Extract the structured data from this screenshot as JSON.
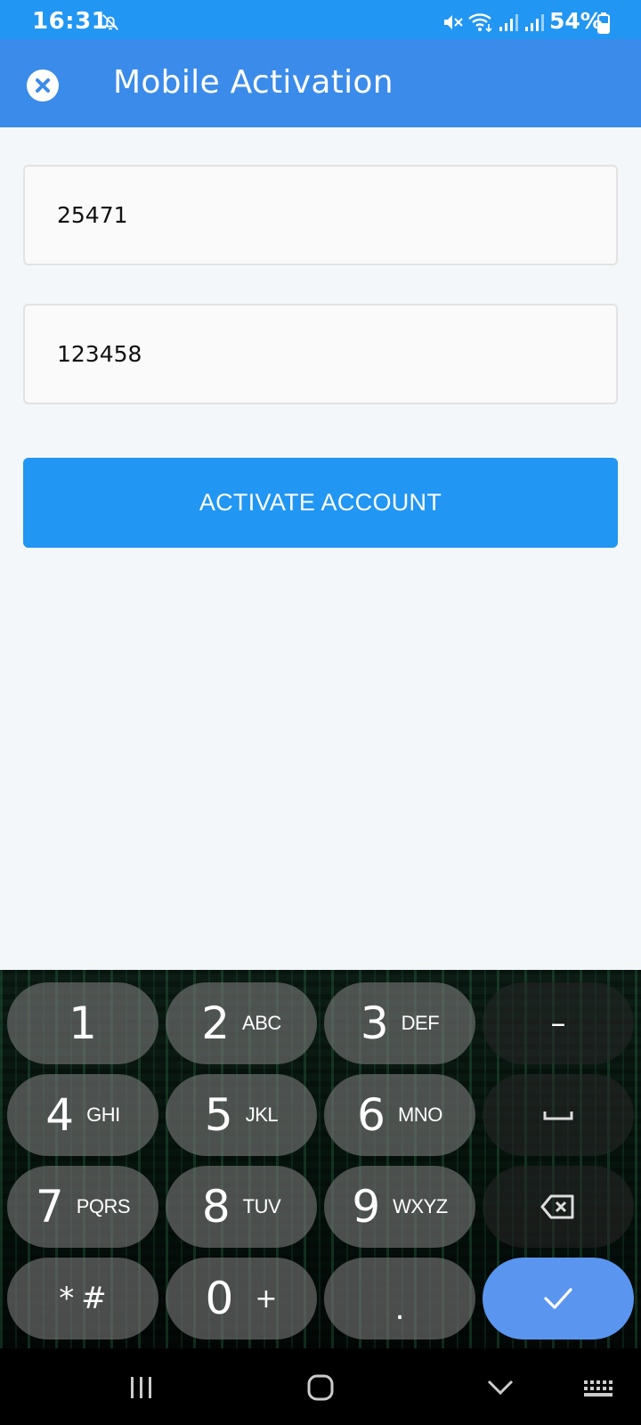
{
  "status_bar": {
    "time": "16:31",
    "battery_pct": "54%"
  },
  "app_bar": {
    "title": "Mobile Activation"
  },
  "form": {
    "account_value": "25471",
    "code_value": "123458",
    "activate_label": "ACTIVATE ACCOUNT"
  },
  "keyboard": {
    "keys": [
      {
        "num": "1",
        "sub": ""
      },
      {
        "num": "2",
        "sub": "ABC"
      },
      {
        "num": "3",
        "sub": "DEF"
      },
      {
        "num": "4",
        "sub": "GHI"
      },
      {
        "num": "5",
        "sub": "JKL"
      },
      {
        "num": "6",
        "sub": "MNO"
      },
      {
        "num": "7",
        "sub": "PQRS"
      },
      {
        "num": "8",
        "sub": "TUV"
      },
      {
        "num": "9",
        "sub": "WXYZ"
      },
      {
        "num": "*",
        "sub": "#"
      },
      {
        "num": "0",
        "sub": "+"
      },
      {
        "num": ".",
        "sub": ""
      }
    ],
    "dash_label": "–"
  },
  "colors": {
    "status_bar": "#2196f3",
    "app_bar": "#3b8bea",
    "button": "#2196f3",
    "done_key": "#5a95ef"
  }
}
